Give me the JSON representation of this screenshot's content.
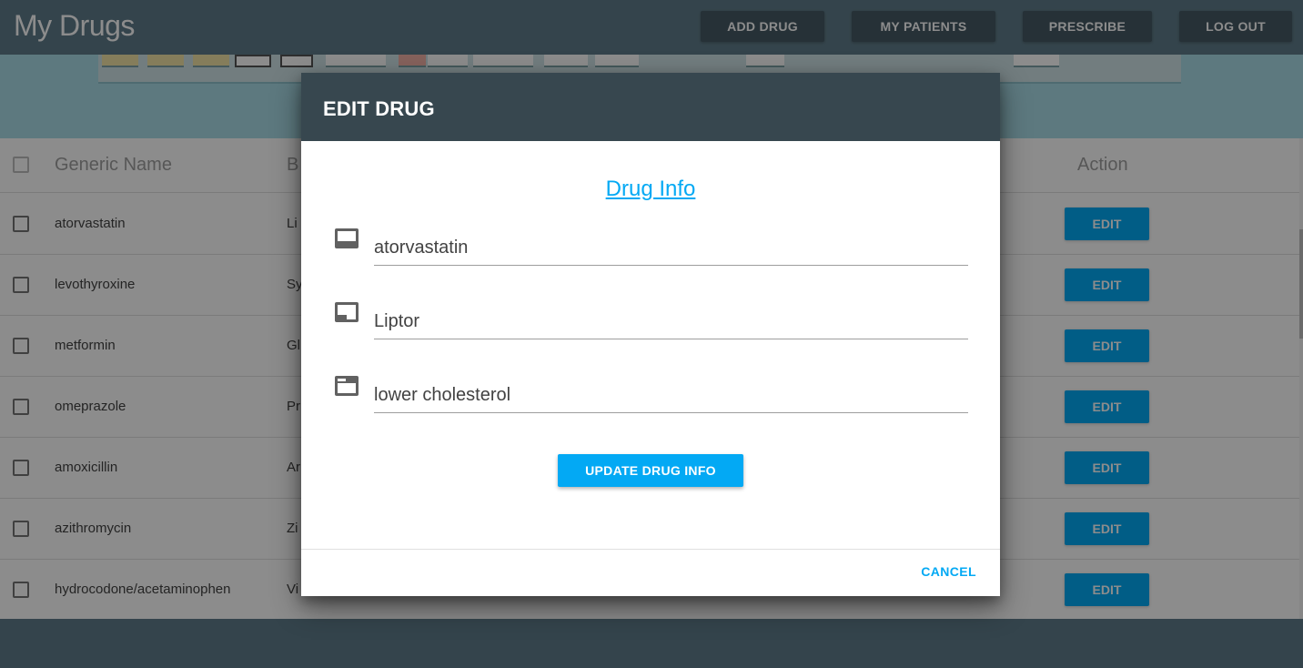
{
  "appbar": {
    "title": "My Drugs",
    "nav": [
      "ADD DRUG",
      "MY PATIENTS",
      "PRESCRIBE",
      "LOG OUT"
    ]
  },
  "table": {
    "headers": {
      "generic": "Generic Name",
      "brand": "B",
      "action": "Action"
    },
    "rows": [
      {
        "generic": "atorvastatin",
        "brand": "Li",
        "action": "EDIT"
      },
      {
        "generic": "levothyroxine",
        "brand": "Sy",
        "action": "EDIT"
      },
      {
        "generic": "metformin",
        "brand": "Gl",
        "action": "EDIT"
      },
      {
        "generic": "omeprazole",
        "brand": "Pr",
        "action": "EDIT"
      },
      {
        "generic": "amoxicillin",
        "brand": "Ar",
        "action": "EDIT"
      },
      {
        "generic": "azithromycin",
        "brand": "Zi",
        "action": "EDIT"
      },
      {
        "generic": "hydrocodone/acetaminophen",
        "brand": "Vi",
        "action": "EDIT"
      }
    ]
  },
  "dialog": {
    "title": "EDIT DRUG",
    "section_title": "Drug Info",
    "fields": [
      {
        "value": "atorvastatin",
        "icon": "generic-name-icon"
      },
      {
        "value": "Liptor",
        "icon": "brand-name-icon"
      },
      {
        "value": "lower cholesterol",
        "icon": "description-icon"
      }
    ],
    "update_label": "UPDATE DRUG INFO",
    "cancel_label": "CANCEL"
  },
  "colors": {
    "appbar": "#607D8B",
    "dialog_header": "#37474F",
    "accent": "#03A9F4"
  }
}
